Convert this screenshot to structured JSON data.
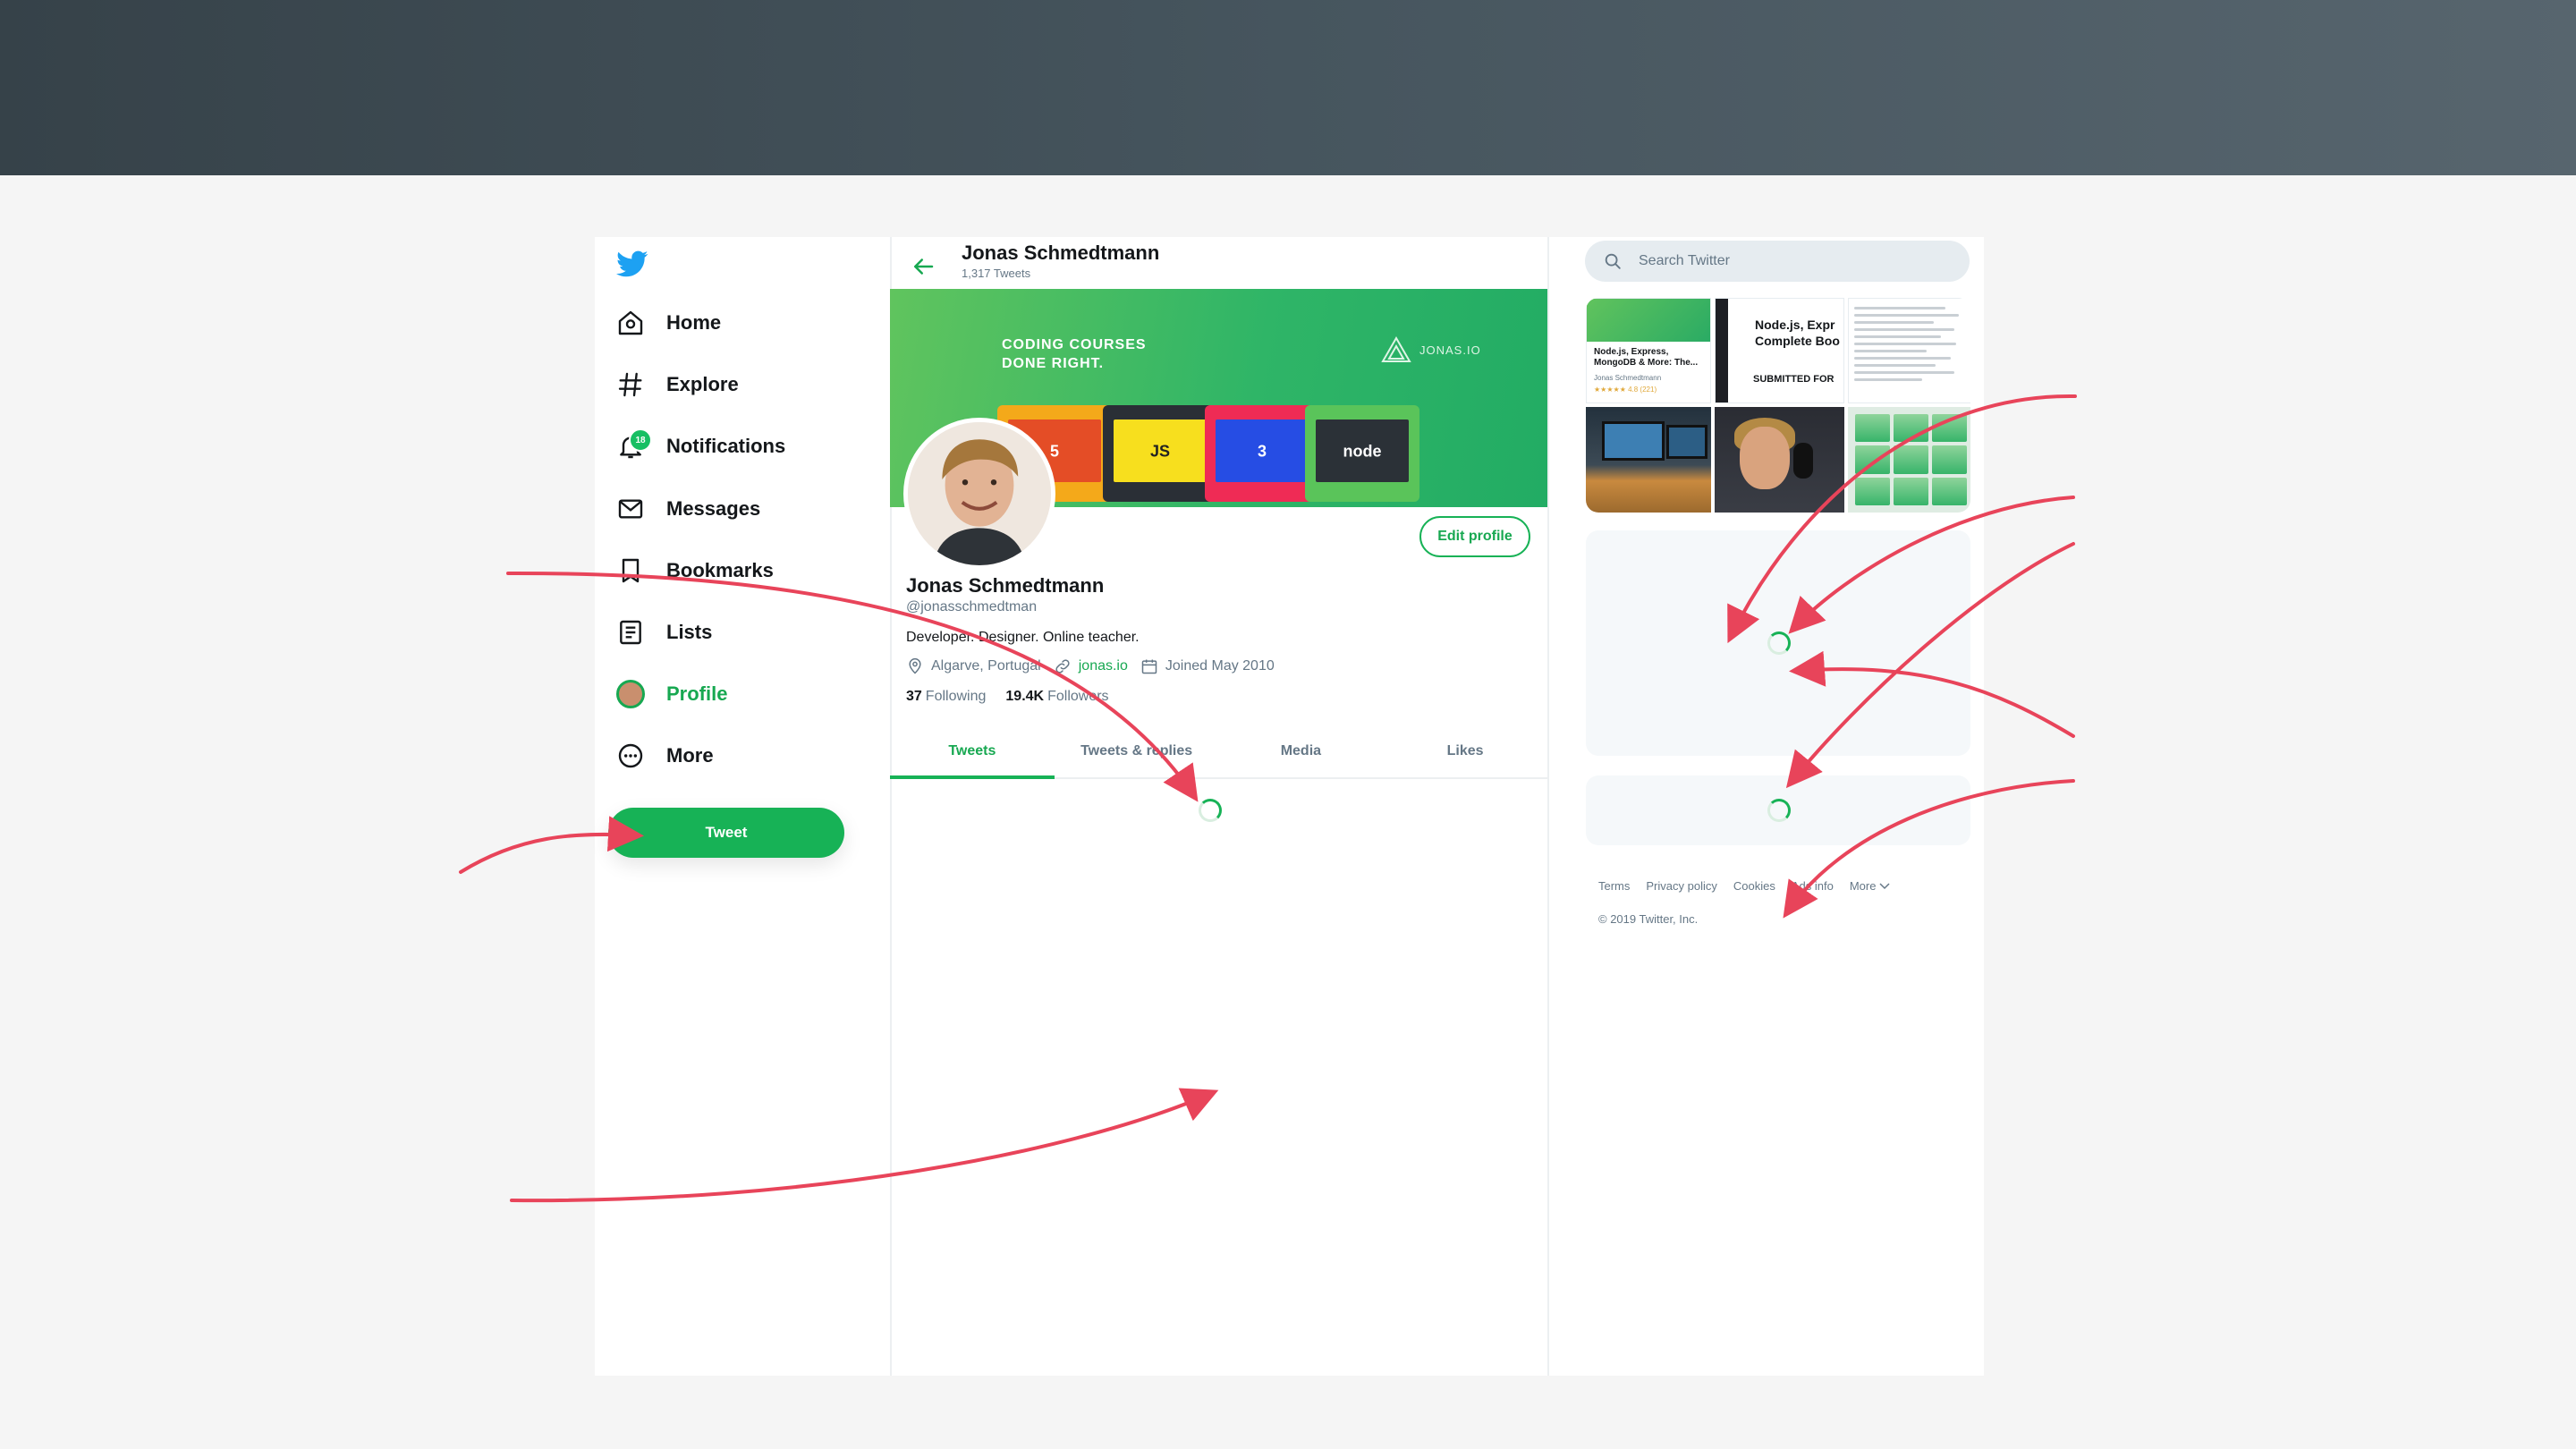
{
  "nav": {
    "items": [
      {
        "id": "home",
        "label": "Home",
        "icon": "home-icon"
      },
      {
        "id": "explore",
        "label": "Explore",
        "icon": "hashtag-icon"
      },
      {
        "id": "notifications",
        "label": "Notifications",
        "icon": "bell-icon",
        "badge": "18"
      },
      {
        "id": "messages",
        "label": "Messages",
        "icon": "envelope-icon"
      },
      {
        "id": "bookmarks",
        "label": "Bookmarks",
        "icon": "bookmark-icon"
      },
      {
        "id": "lists",
        "label": "Lists",
        "icon": "list-icon"
      },
      {
        "id": "profile",
        "label": "Profile",
        "icon": "avatar",
        "active": true
      },
      {
        "id": "more",
        "label": "More",
        "icon": "more-icon"
      }
    ],
    "tweet_button": "Tweet"
  },
  "header": {
    "name": "Jonas Schmedtmann",
    "tweet_count": "1,317 Tweets"
  },
  "banner": {
    "headline": "CODING COURSES\nDONE RIGHT.",
    "brand": "JONAS.IO",
    "laptops": [
      "5",
      "JS",
      "3",
      "node"
    ]
  },
  "profile": {
    "edit_button": "Edit profile",
    "name": "Jonas Schmedtmann",
    "handle": "@jonasschmedtman",
    "bio": "Developer. Designer. Online teacher.",
    "location": "Algarve, Portugal",
    "website": "jonas.io",
    "joined": "Joined May 2010",
    "following_count": "37",
    "following_label": "Following",
    "followers_count": "19.4K",
    "followers_label": "Followers"
  },
  "tabs": [
    "Tweets",
    "Tweets & replies",
    "Media",
    "Likes"
  ],
  "search": {
    "placeholder": "Search Twitter"
  },
  "media": {
    "card1_title": "Node.js, Express, MongoDB & More: The...",
    "card1_author": "Jonas Schmedtmann",
    "card1_rating": "★★★★★ 4.8 (221)",
    "card2_title": "Node.js, Expr\nComplete Boo",
    "card2_sub": "SUBMITTED FOR"
  },
  "footer": {
    "links": [
      "Terms",
      "Privacy policy",
      "Cookies",
      "Ads info",
      "More"
    ],
    "copyright": "© 2019 Twitter, Inc."
  },
  "colors": {
    "accent": "#17b256",
    "arrow": "#e8445a",
    "header": "#46555e"
  }
}
